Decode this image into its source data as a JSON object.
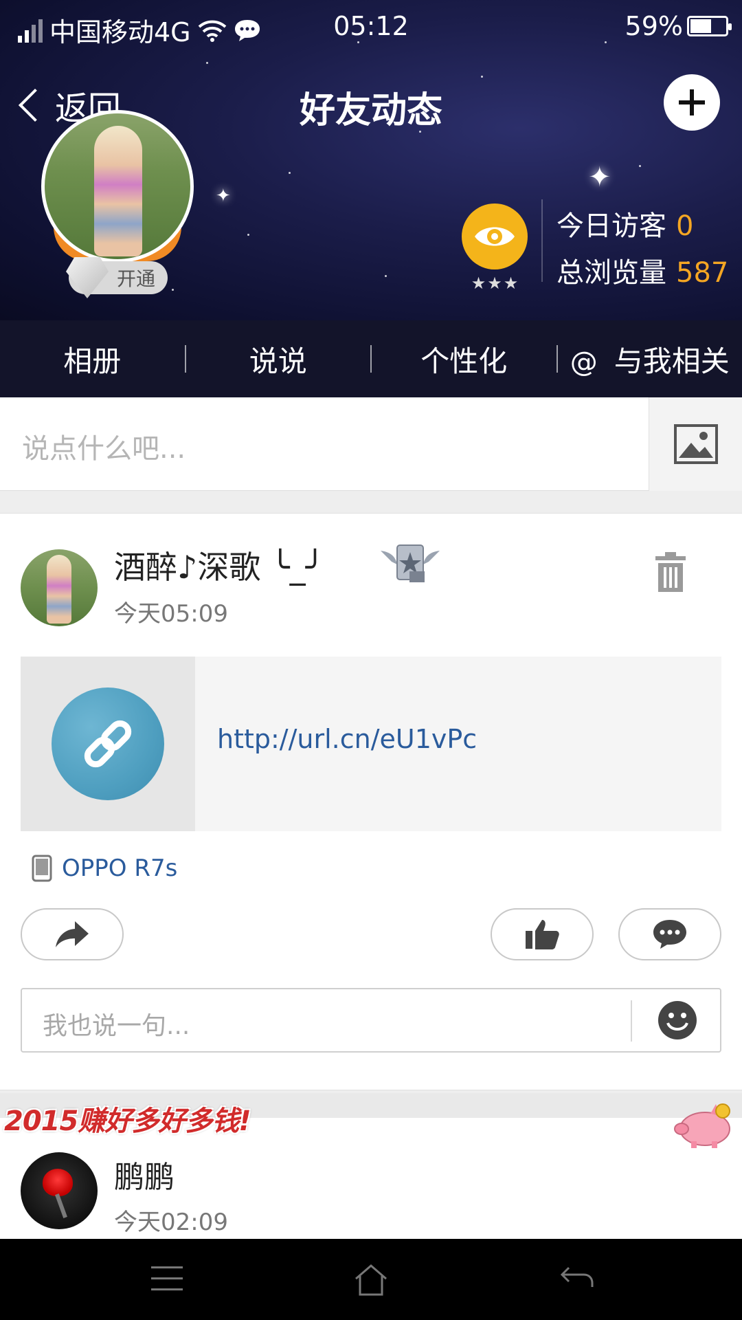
{
  "status_bar": {
    "carrier": "中国移动4G",
    "time": "05:12",
    "battery_percent": "59%",
    "battery_level": 0.59
  },
  "nav": {
    "back_label": "返回",
    "title": "好友动态"
  },
  "profile": {
    "vip_label": "开通",
    "visitors_label": "今日访客",
    "visitors_value": "0",
    "views_label": "总浏览量",
    "views_value": "587",
    "level_stars": "★★★"
  },
  "tabs": [
    {
      "label": "相册"
    },
    {
      "label": "说说"
    },
    {
      "label": "个性化"
    },
    {
      "label": "与我相关",
      "prefix": "@"
    }
  ],
  "composer": {
    "placeholder": "说点什么吧..."
  },
  "feed": [
    {
      "username": "酒醉♪深歌 ╰_╯",
      "time": "今天05:09",
      "link_url": "http://url.cn/eU1vPc",
      "device": "OPPO R7s",
      "reply_placeholder": "我也说一句..."
    },
    {
      "username": "鹏鹏",
      "time": "今天02:09"
    }
  ],
  "banner": {
    "text": "2015赚好多好多钱!"
  },
  "colors": {
    "accent_orange": "#f4a623",
    "link_blue": "#2a5b9c",
    "tab_bg": "#13142a",
    "eye_yellow": "#f4b41a"
  },
  "icons": [
    "wifi-icon",
    "message-icon",
    "plus-icon",
    "eye-icon",
    "image-icon",
    "trash-icon",
    "link-icon",
    "phone-icon",
    "share-icon",
    "like-icon",
    "comment-icon",
    "smile-icon",
    "menu-icon",
    "home-icon",
    "back-icon"
  ]
}
